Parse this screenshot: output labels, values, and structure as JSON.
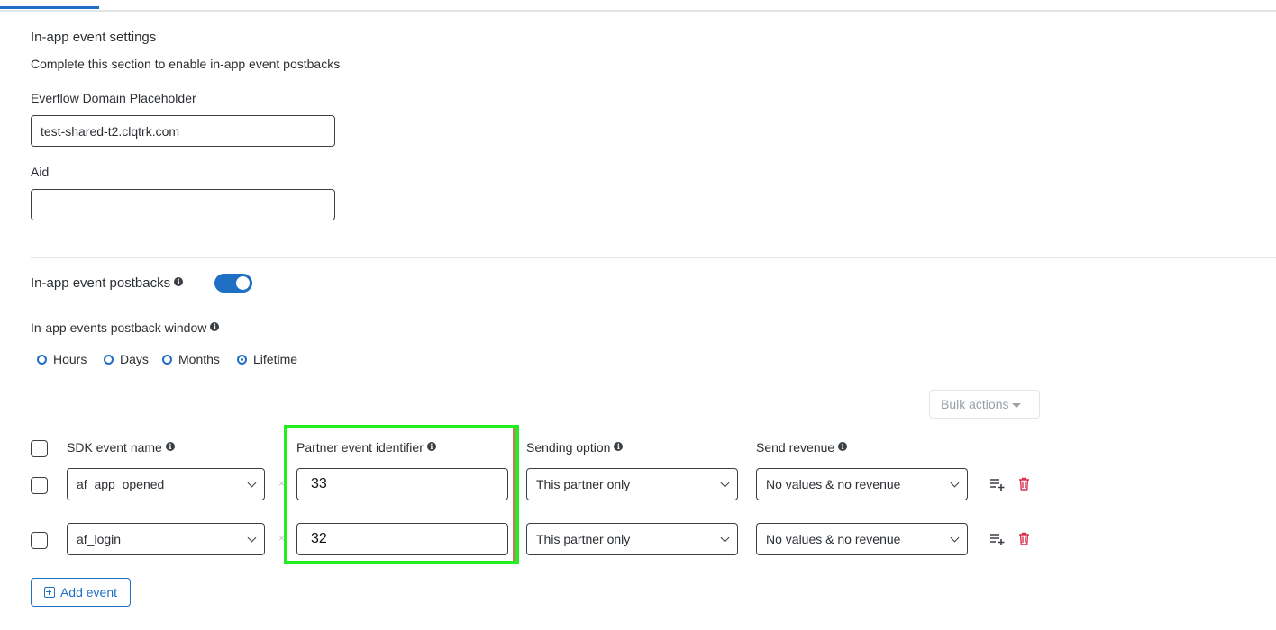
{
  "section": {
    "title": "In-app event settings",
    "description": "Complete this section to enable in-app event postbacks"
  },
  "domain_field": {
    "label": "Everflow Domain Placeholder",
    "value": "test-shared-t2.clqtrk.com"
  },
  "aid_field": {
    "label": "Aid",
    "value": ""
  },
  "postbacks": {
    "label": "In-app event postbacks",
    "enabled": true
  },
  "window": {
    "label": "In-app events postback window",
    "options": [
      "Hours",
      "Days",
      "Months",
      "Lifetime"
    ],
    "selected": "Lifetime"
  },
  "bulk_actions": {
    "label": "Bulk actions"
  },
  "table": {
    "headers": {
      "sdk_event": "SDK event name",
      "partner_id": "Partner event identifier",
      "sending": "Sending option",
      "revenue": "Send revenue"
    },
    "rows": [
      {
        "sdk_event": "af_app_opened",
        "partner_id": "33",
        "sending": "This partner only",
        "revenue": "No values & no revenue"
      },
      {
        "sdk_event": "af_login",
        "partner_id": "32",
        "sending": "This partner only",
        "revenue": "No values & no revenue"
      }
    ]
  },
  "add_event": {
    "label": "Add event"
  },
  "colors": {
    "accent": "#1f6fc5",
    "delete": "#d9304f",
    "highlight": "#22ee22"
  }
}
